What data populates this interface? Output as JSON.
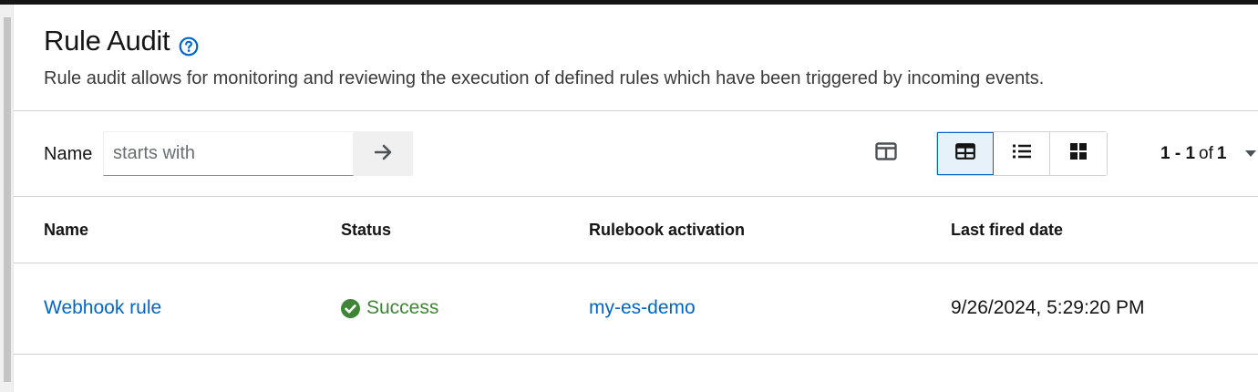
{
  "header": {
    "title": "Rule Audit",
    "description": "Rule audit allows for monitoring and reviewing the execution of defined rules which have been triggered by incoming events."
  },
  "toolbar": {
    "filter_label": "Name",
    "filter_placeholder": "starts with",
    "filter_value": "",
    "pagination": {
      "range": "1 - 1",
      "of_word": "of",
      "total": "1"
    },
    "view_modes": [
      "table",
      "list",
      "cards"
    ],
    "active_view": "table",
    "icons": {
      "help": "help-circle-icon",
      "submit": "arrow-right-icon",
      "columns": "column-manage-icon",
      "table": "table-view-icon",
      "list": "list-view-icon",
      "cards": "cards-view-icon",
      "caret": "caret-down-icon"
    }
  },
  "table": {
    "columns": [
      "Name",
      "Status",
      "Rulebook activation",
      "Last fired date"
    ],
    "rows": [
      {
        "name": "Webhook rule",
        "status": "Success",
        "rulebook_activation": "my-es-demo",
        "last_fired_date": "9/26/2024, 5:29:20 PM"
      }
    ]
  },
  "colors": {
    "link": "#0066cc",
    "success": "#3e8635",
    "active_view_bg": "#e7f1fa"
  }
}
